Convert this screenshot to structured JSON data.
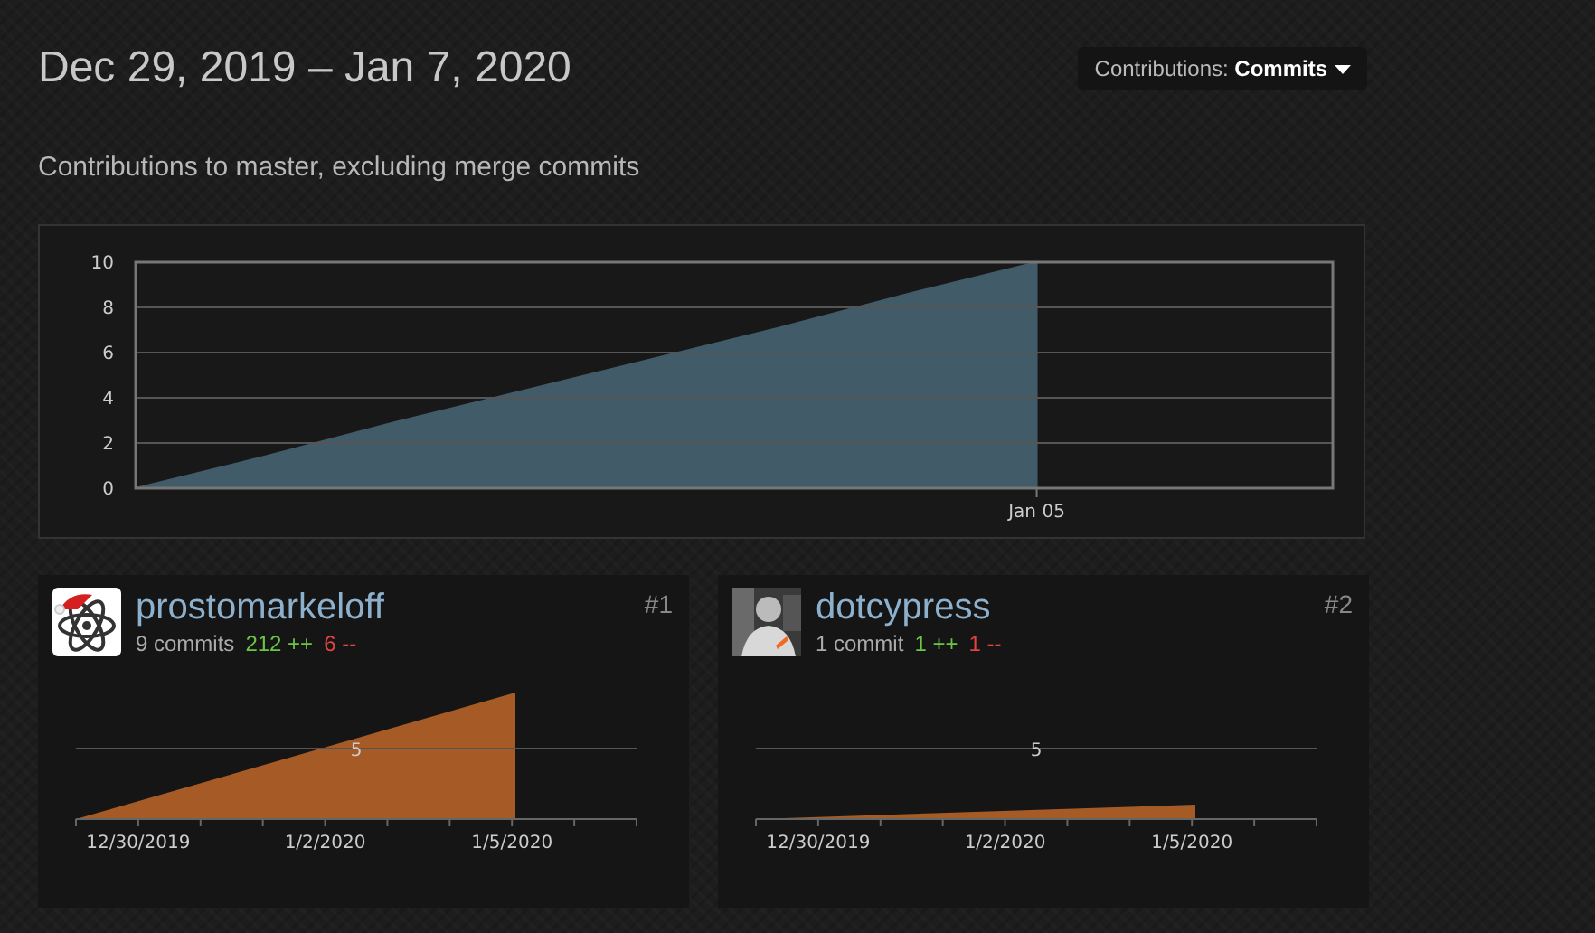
{
  "header": {
    "title": "Dec 29, 2019 – Jan 7, 2020",
    "dropdown": {
      "label": "Contributions:",
      "value": "Commits"
    }
  },
  "subtitle": "Contributions to master, excluding merge commits",
  "overview": {
    "chart_data": {
      "type": "area",
      "categories": [
        null,
        null,
        null,
        null,
        null,
        null,
        null,
        "Jan 05",
        null,
        null
      ],
      "series": [
        {
          "color": "#415b69",
          "values": [
            0,
            1.4,
            2.9,
            4.3,
            5.7,
            7.1,
            8.6,
            10,
            null,
            null
          ]
        }
      ],
      "grid": true,
      "ylim": [
        0,
        10
      ],
      "yticks": [
        {
          "value": 0,
          "label": "0"
        },
        {
          "value": 2,
          "label": "2"
        },
        {
          "value": 4,
          "label": "4"
        },
        {
          "value": 6,
          "label": "6"
        },
        {
          "value": 8,
          "label": "8"
        },
        {
          "value": 10,
          "label": "10"
        }
      ]
    }
  },
  "contributors": [
    {
      "avatar": {
        "kind": "atom"
      },
      "name": "prostomarkeloff",
      "commits": "9 commits",
      "additions": "212 ++",
      "deletions": "6 --",
      "rank": "#1",
      "activity": {
        "kind": "steep",
        "gridline_label": "5",
        "date_labels": [
          "12/30/2019",
          "1/2/2020",
          "1/5/2020"
        ]
      }
    },
    {
      "name": "dotcypress",
      "commits": "1 commit",
      "additions": "1 ++",
      "deletions": "1 --",
      "rank": "#2",
      "activity": {
        "kind": "shallow",
        "gridline_label": "5",
        "date_labels": [
          "12/30/2019",
          "1/2/2020",
          "1/5/2020"
        ]
      }
    }
  ]
}
